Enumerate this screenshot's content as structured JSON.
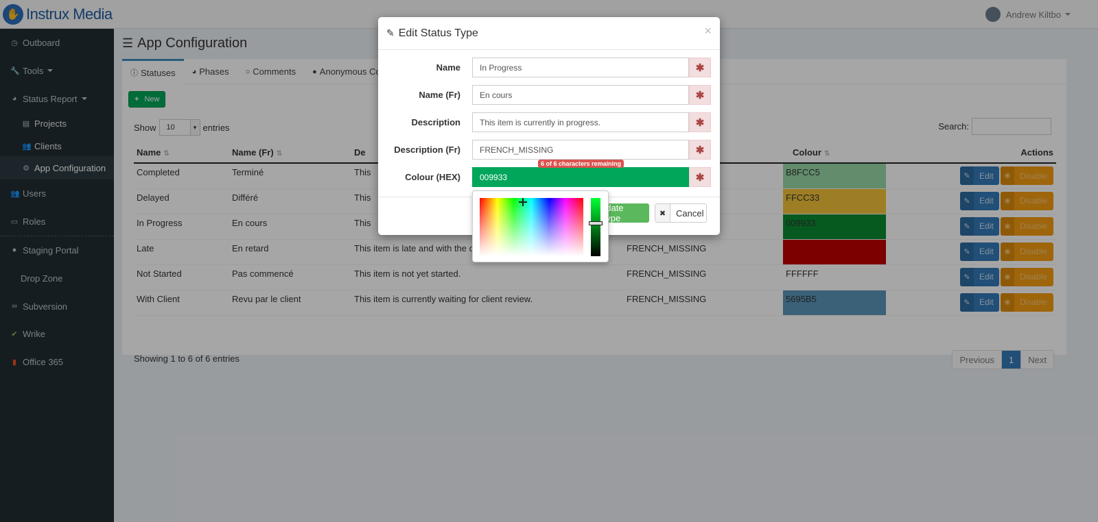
{
  "brand": {
    "name": "Instrux",
    "suffix": " Media"
  },
  "user": {
    "name": "Andrew Kiltbo"
  },
  "sidebar": {
    "items": [
      {
        "label": "Outboard",
        "icon": "clock-icon"
      },
      {
        "label": "Tools",
        "icon": "wrench-icon"
      },
      {
        "label": "Status Report",
        "icon": "pie-chart-icon"
      },
      {
        "label": "Projects",
        "icon": "list-icon"
      },
      {
        "label": "Clients",
        "icon": "users-icon"
      },
      {
        "label": "App Configuration",
        "icon": "cogs-icon"
      },
      {
        "label": "Users",
        "icon": "users-icon"
      },
      {
        "label": "Roles",
        "icon": "id-card-icon"
      },
      {
        "label": "Staging Portal",
        "icon": "drop-icon"
      },
      {
        "label": "Drop Zone",
        "icon": ""
      },
      {
        "label": "Subversion",
        "icon": "link-icon"
      },
      {
        "label": "Wrike",
        "icon": "check-icon"
      },
      {
        "label": "Office 365",
        "icon": "office-icon"
      }
    ]
  },
  "page": {
    "title": "App Configuration",
    "tabs": [
      "Statuses",
      "Phases",
      "Comments",
      "Anonymous Co"
    ],
    "new_label": "New",
    "show_label": "Show",
    "entries_label": "entries",
    "page_length": "10",
    "search_label": "Search:"
  },
  "table": {
    "headers": [
      "Name",
      "Name (Fr)",
      "De",
      "Colour",
      "Actions"
    ],
    "rows": [
      {
        "name": "Completed",
        "name_fr": "Terminé",
        "desc": "This",
        "desc_fr": "",
        "colour": "B8FCC5",
        "colour_hex": "#98d8a8"
      },
      {
        "name": "Delayed",
        "name_fr": "Différé",
        "desc": "This",
        "desc_fr": "",
        "colour": "FFCC33",
        "colour_hex": "#f2c23a"
      },
      {
        "name": "In Progress",
        "name_fr": "En cours",
        "desc": "This",
        "desc_fr": "",
        "colour": "009933",
        "colour_hex": "#0a8a30"
      },
      {
        "name": "Late",
        "name_fr": "En retard",
        "desc": "This item is late and with the cli",
        "desc_fr": "FRENCH_MISSING",
        "colour": "",
        "colour_hex": "#c00000"
      },
      {
        "name": "Not Started",
        "name_fr": "Pas commencé",
        "desc": "This item is not yet started.",
        "desc_fr": "FRENCH_MISSING",
        "colour": "FFFFFF",
        "colour_hex": "#ffffff"
      },
      {
        "name": "With Client",
        "name_fr": "Revu par le client",
        "desc": "This item is currently waiting for client review.",
        "desc_fr": "FRENCH_MISSING",
        "colour": "5695B5",
        "colour_hex": "#5a96b8"
      }
    ],
    "edit_label": "Edit",
    "disable_label": "Disable",
    "info": "Showing 1 to 6 of 6 entries",
    "pager": {
      "prev": "Previous",
      "current": "1",
      "next": "Next"
    }
  },
  "modal": {
    "title": "Edit Status Type",
    "close": "×",
    "fields": [
      {
        "label": "Name",
        "value": "In Progress"
      },
      {
        "label": "Name (Fr)",
        "value": "En cours"
      },
      {
        "label": "Description",
        "value": "This item is currently in progress."
      },
      {
        "label": "Description (Fr)",
        "value": "FRENCH_MISSING"
      },
      {
        "label": "Colour (HEX)",
        "value": "009933"
      }
    ],
    "char_counter": "6 of 6 characters remaining",
    "update_label": "pdate Type",
    "cancel_label": "Cancel"
  },
  "colors": {
    "accent": "#3c8dbc",
    "success": "#00a65a",
    "warning": "#f39c12",
    "sidebar": "#222d32"
  }
}
